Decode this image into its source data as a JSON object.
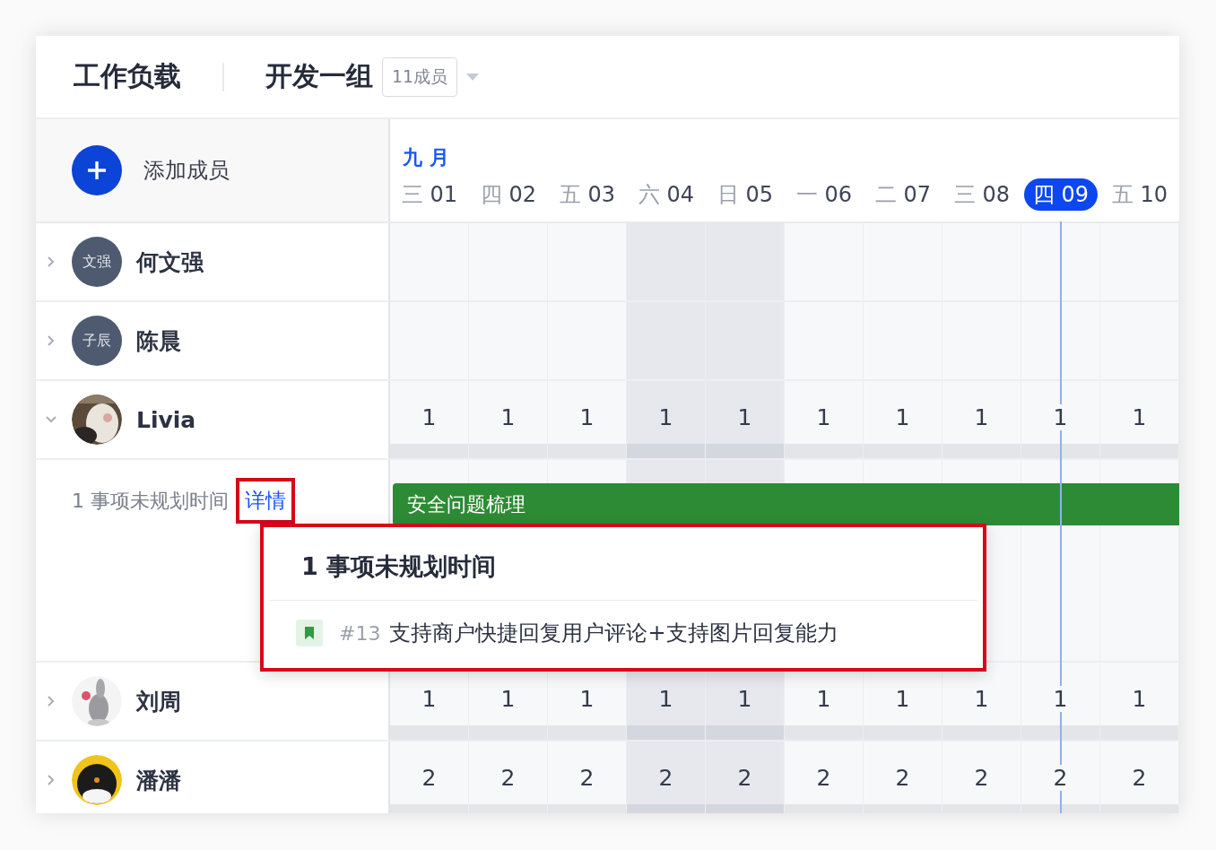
{
  "header": {
    "title": "工作负载",
    "team": "开发一组",
    "member_count": "11成员"
  },
  "add_member": {
    "label": "添加成员"
  },
  "calendar": {
    "month": "九 月",
    "days": [
      {
        "weekday": "三",
        "date": "01",
        "selected": false,
        "weekend": false
      },
      {
        "weekday": "四",
        "date": "02",
        "selected": false,
        "weekend": false
      },
      {
        "weekday": "五",
        "date": "03",
        "selected": false,
        "weekend": false
      },
      {
        "weekday": "六",
        "date": "04",
        "selected": false,
        "weekend": true
      },
      {
        "weekday": "日",
        "date": "05",
        "selected": false,
        "weekend": true
      },
      {
        "weekday": "一",
        "date": "06",
        "selected": false,
        "weekend": false
      },
      {
        "weekday": "二",
        "date": "07",
        "selected": false,
        "weekend": false
      },
      {
        "weekday": "三",
        "date": "08",
        "selected": false,
        "weekend": false
      },
      {
        "weekday": "四",
        "date": "09",
        "selected": true,
        "weekend": false
      },
      {
        "weekday": "五",
        "date": "10",
        "selected": false,
        "weekend": false
      }
    ]
  },
  "members": [
    {
      "name": "何文强",
      "expanded": false,
      "avatar": {
        "kind": "initials",
        "text": "文强"
      }
    },
    {
      "name": "陈晨",
      "expanded": false,
      "avatar": {
        "kind": "initials",
        "text": "子辰"
      }
    },
    {
      "name": "Livia",
      "expanded": true,
      "workload": [
        "1",
        "1",
        "1",
        "1",
        "1",
        "1",
        "1",
        "1",
        "1",
        "1"
      ],
      "unplanned": {
        "text": "1 事项未规划时间",
        "link": "详情",
        "highlighted": true
      },
      "tasks": [
        {
          "title": "安全问题梳理"
        }
      ]
    },
    {
      "name": "刘周",
      "expanded": false,
      "workload": [
        "1",
        "1",
        "1",
        "1",
        "1",
        "1",
        "1",
        "1",
        "1",
        "1"
      ]
    },
    {
      "name": "潘潘",
      "expanded": false,
      "workload": [
        "2",
        "2",
        "2",
        "2",
        "2",
        "2",
        "2",
        "2",
        "2",
        "2"
      ]
    }
  ],
  "popup": {
    "title": "1 事项未规划时间",
    "highlighted": true,
    "items": [
      {
        "number": "#13",
        "title": "支持商户快捷回复用户评论+支持图片回复能力"
      }
    ]
  }
}
